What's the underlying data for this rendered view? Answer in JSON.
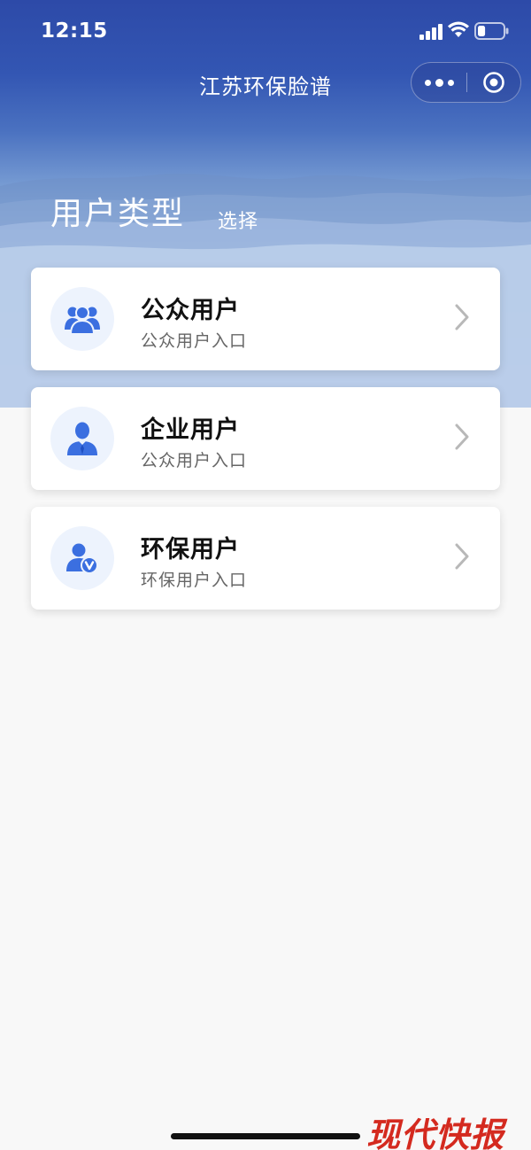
{
  "status_bar": {
    "time": "12:15",
    "signal_icon": "signal-bars-icon",
    "wifi_icon": "wifi-icon",
    "battery_icon": "battery-icon",
    "battery_level": 0.3
  },
  "nav": {
    "title": "江苏环保脸谱",
    "more_icon": "more-dots-icon",
    "close_icon": "target-close-icon"
  },
  "header": {
    "title": "用户类型",
    "subtitle": "选择"
  },
  "user_types": [
    {
      "title": "公众用户",
      "description": "公众用户入口",
      "icon": "group-users-icon"
    },
    {
      "title": "企业用户",
      "description": "公众用户入口",
      "icon": "business-user-icon"
    },
    {
      "title": "环保用户",
      "description": "环保用户入口",
      "icon": "verified-user-icon"
    }
  ],
  "watermark": "现代快报",
  "colors": {
    "accent": "#3b6fe0",
    "header_blue": "#2d4aa8",
    "watermark_red": "#d42a1f"
  }
}
